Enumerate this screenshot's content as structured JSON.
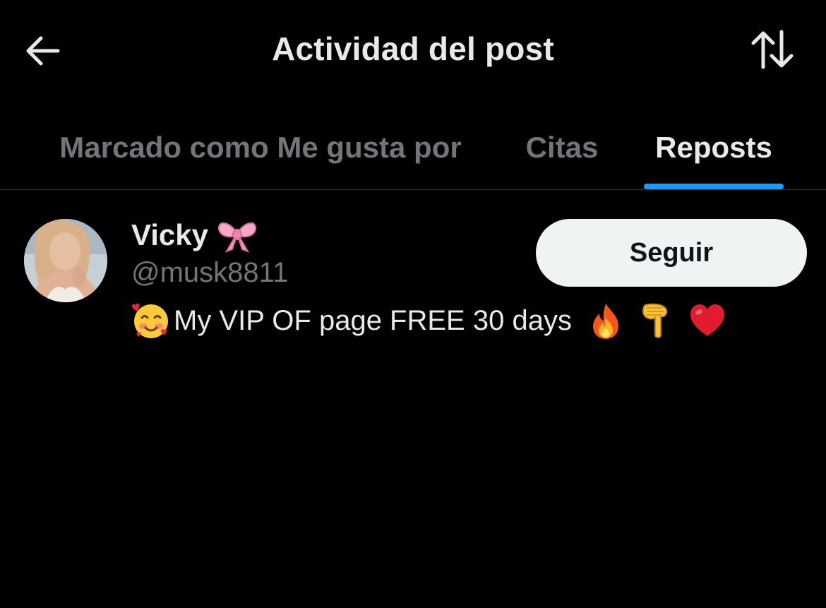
{
  "header": {
    "title": "Actividad del post",
    "back_icon": "arrow-left-icon",
    "sort_icon": "sort-arrows-icon"
  },
  "tabs": [
    {
      "label": "Marcado como Me gusta por",
      "active": false
    },
    {
      "label": "Citas",
      "active": false
    },
    {
      "label": "Reposts",
      "active": true
    }
  ],
  "user": {
    "name": "Vicky",
    "name_emoji": "ribbon-bow-icon",
    "handle": "@musk8811",
    "follow_label": "Seguir",
    "bio_text": "My VIP OF page FREE 30 days",
    "bio_emojis": [
      "smiling-face-with-hearts-icon",
      "fire-icon",
      "backhand-index-pointing-down-icon",
      "red-heart-icon"
    ]
  },
  "colors": {
    "background": "#000000",
    "text_primary": "#e7e9ea",
    "text_secondary": "#71767b",
    "accent": "#1d9bf0",
    "follow_button_bg": "#eff3f4",
    "follow_button_text": "#0f1419",
    "divider": "#2f3336"
  }
}
